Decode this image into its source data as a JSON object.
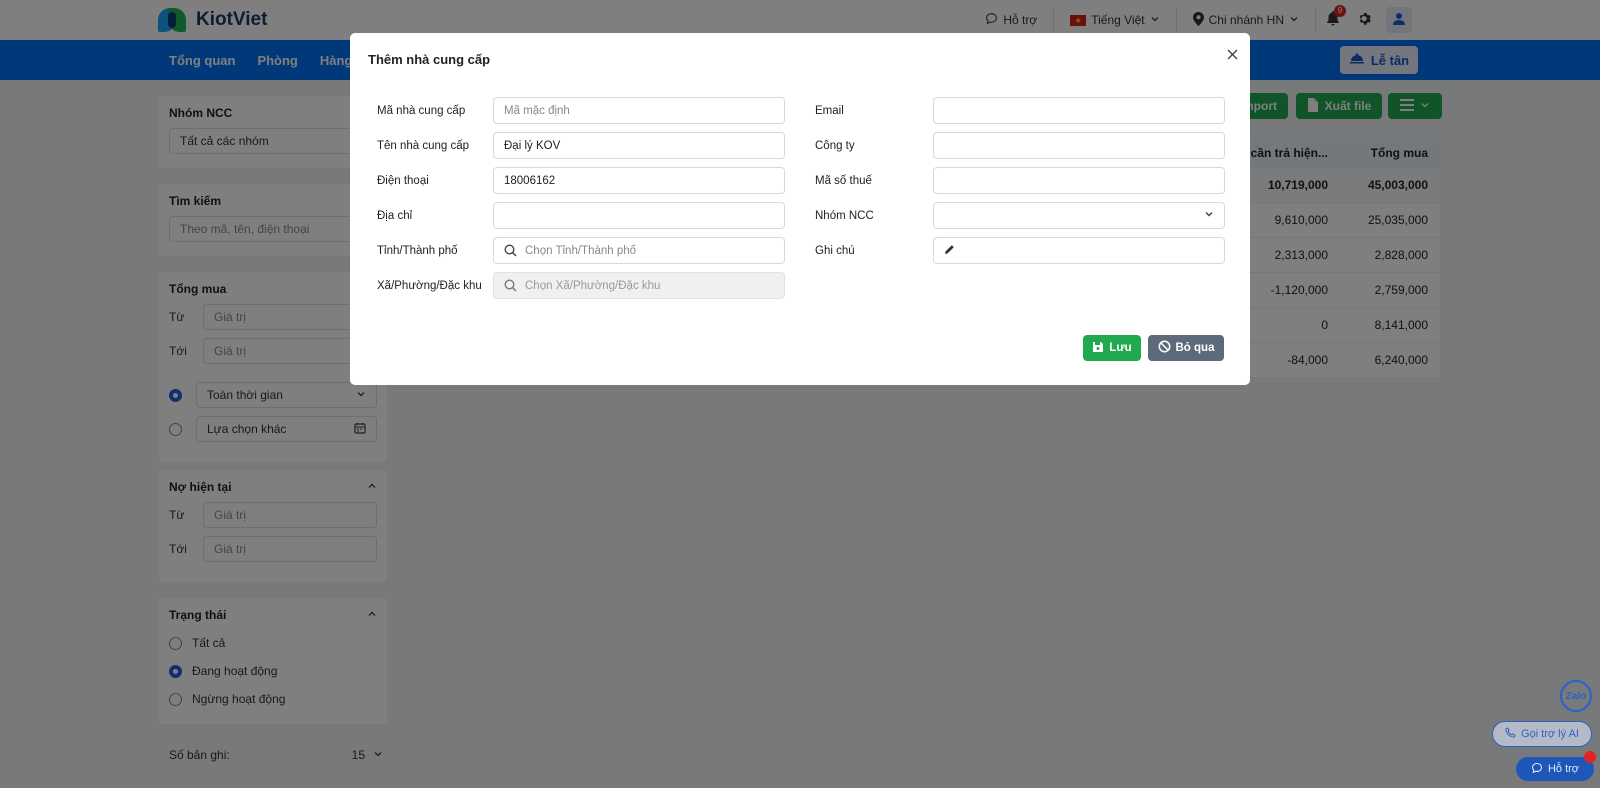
{
  "brand": {
    "name": "KiotViet"
  },
  "topbar": {
    "support": "Hỗ trợ",
    "language": "Tiếng Việt",
    "branch": "Chi nhánh HN",
    "notifications_count": "9"
  },
  "nav": {
    "items": [
      "Tổng quan",
      "Phòng",
      "Hàng"
    ],
    "reception": "Lễ tân"
  },
  "sidebar": {
    "group": {
      "title": "Nhóm NCC",
      "value": "Tất cả các nhóm"
    },
    "search": {
      "title": "Tìm kiếm",
      "placeholder": "Theo mã, tên, điện thoại"
    },
    "total_purchase": {
      "title": "Tổng mua",
      "from_label": "Từ",
      "to_label": "Tới",
      "value_placeholder": "Giá trị",
      "time_all": "Toàn thời gian",
      "time_other": "Lựa chọn khác"
    },
    "current_debt": {
      "title": "Nợ hiện tại",
      "from_label": "Từ",
      "to_label": "Tới",
      "value_placeholder": "Giá trị"
    },
    "status": {
      "title": "Trạng thái",
      "options": [
        "Tất cả",
        "Đang hoạt động",
        "Ngừng hoạt động"
      ],
      "selected": "Đang hoạt động"
    },
    "records": {
      "label": "Số bản ghi:",
      "value": "15"
    }
  },
  "toolbar": {
    "import": "mport",
    "export": "Xuất file"
  },
  "table": {
    "headers": [
      "' cần trả hiện...",
      "Tổng mua"
    ],
    "summary": [
      "10,719,000",
      "45,003,000"
    ],
    "rows": [
      [
        "9,610,000",
        "25,035,000"
      ],
      [
        "2,313,000",
        "2,828,000"
      ],
      [
        "-1,120,000",
        "2,759,000"
      ],
      [
        "0",
        "8,141,000"
      ],
      [
        "-84,000",
        "6,240,000"
      ]
    ]
  },
  "modal": {
    "title": "Thêm nhà cung cấp",
    "left": [
      {
        "label": "Mã nhà cung cấp",
        "value": "",
        "placeholder": "Mã mặc định"
      },
      {
        "label": "Tên nhà cung cấp",
        "value": "Đại lý KOV",
        "placeholder": ""
      },
      {
        "label": "Điện thoại",
        "value": "18006162",
        "placeholder": ""
      },
      {
        "label": "Địa chỉ",
        "value": "",
        "placeholder": ""
      },
      {
        "label": "Tỉnh/Thành phố",
        "value": "",
        "placeholder": "Chọn Tỉnh/Thành phố"
      },
      {
        "label": "Xã/Phường/Đặc khu",
        "value": "",
        "placeholder": "Chọn Xã/Phường/Đặc khu"
      }
    ],
    "right": [
      {
        "label": "Email",
        "value": ""
      },
      {
        "label": "Công ty",
        "value": ""
      },
      {
        "label": "Mã số thuế",
        "value": ""
      },
      {
        "label": "Nhóm NCC",
        "value": ""
      },
      {
        "label": "Ghi chú",
        "value": ""
      }
    ],
    "save": "Lưu",
    "cancel": "Bỏ qua"
  },
  "widgets": {
    "zalo": "Zalo",
    "ai_assistant": "Gọi trợ lý AI",
    "help": "Hỗ trợ"
  },
  "colors": {
    "primary_blue": "#0070f4",
    "green": "#21a94f",
    "gray_button": "#5d6a7c"
  }
}
